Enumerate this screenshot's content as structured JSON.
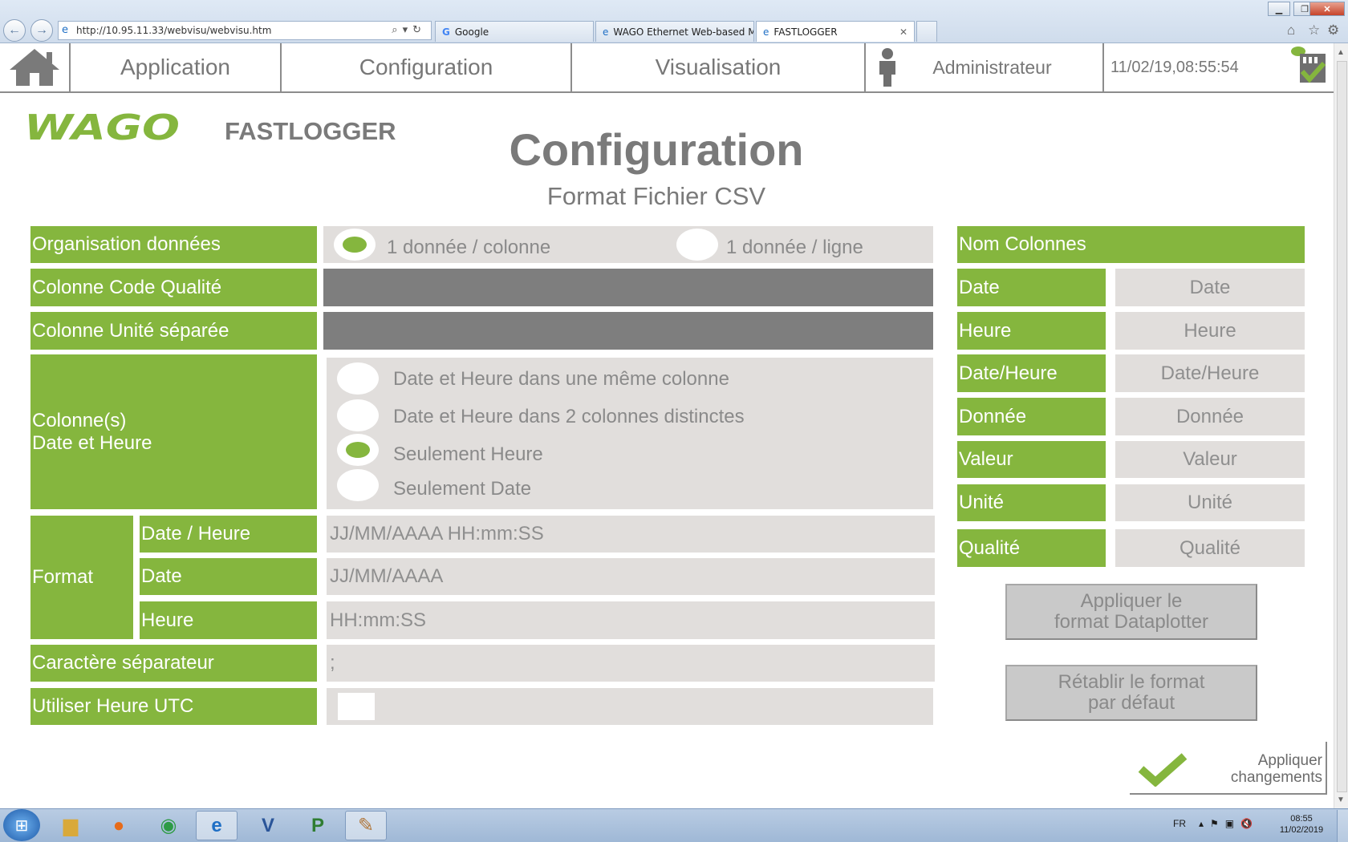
{
  "browser": {
    "url": "http://10.95.11.33/webvisu/webvisu.htm",
    "tabs": [
      {
        "label": "Google"
      },
      {
        "label": "WAGO Ethernet Web-based M..."
      },
      {
        "label": "FASTLOGGER"
      }
    ],
    "tab_close": "✕"
  },
  "menu": {
    "application": "Application",
    "configuration": "Configuration",
    "visualisation": "Visualisation",
    "user": "Administrateur",
    "datetime": "11/02/19,08:55:54"
  },
  "header": {
    "logo": "WAGO",
    "product": "FASTLOGGER",
    "title": "Configuration",
    "subtitle": "Format Fichier CSV"
  },
  "form": {
    "organisation": {
      "label": "Organisation données",
      "option_column": "1 donnée / colonne",
      "option_line": "1 donnée / ligne",
      "selected": "1 donnée / colonne"
    },
    "quality_column_label": "Colonne Code Qualité",
    "unit_column_label": "Colonne Unité séparée",
    "date_time_columns": {
      "label_line1": "Colonne(s)",
      "label_line2": "Date et Heure",
      "options": [
        "Date et Heure dans une même colonne",
        "Date et Heure dans 2 colonnes distinctes",
        "Seulement Heure",
        "Seulement Date"
      ],
      "selected": "Seulement Heure"
    },
    "format": {
      "label": "Format",
      "datetime_label": "Date / Heure",
      "datetime_value": "JJ/MM/AAAA HH:mm:SS",
      "date_label": "Date",
      "date_value": "JJ/MM/AAAA",
      "time_label": "Heure",
      "time_value": "HH:mm:SS"
    },
    "separator": {
      "label": "Caractère séparateur",
      "value": ";"
    },
    "utc": {
      "label": "Utiliser Heure UTC",
      "checked": false
    }
  },
  "column_names": {
    "header": "Nom Colonnes",
    "rows": [
      {
        "label": "Date",
        "value": "Date"
      },
      {
        "label": "Heure",
        "value": "Heure"
      },
      {
        "label": "Date/Heure",
        "value": "Date/Heure"
      },
      {
        "label": "Donnée",
        "value": "Donnée"
      },
      {
        "label": "Valeur",
        "value": "Valeur"
      },
      {
        "label": "Unité",
        "value": "Unité"
      },
      {
        "label": "Qualité",
        "value": "Qualité"
      }
    ]
  },
  "buttons": {
    "apply_dataplotter_l1": "Appliquer le",
    "apply_dataplotter_l2": "format Dataplotter",
    "reset_default_l1": "Rétablir le format",
    "reset_default_l2": "par défaut",
    "apply_changes_l1": "Appliquer",
    "apply_changes_l2": "changements"
  },
  "taskbar": {
    "lang": "FR",
    "time": "08:55",
    "date": "11/02/2019"
  },
  "colors": {
    "green": "#85b63e",
    "grey_field": "#e1dedc",
    "dark_field": "#7e7e7e"
  }
}
